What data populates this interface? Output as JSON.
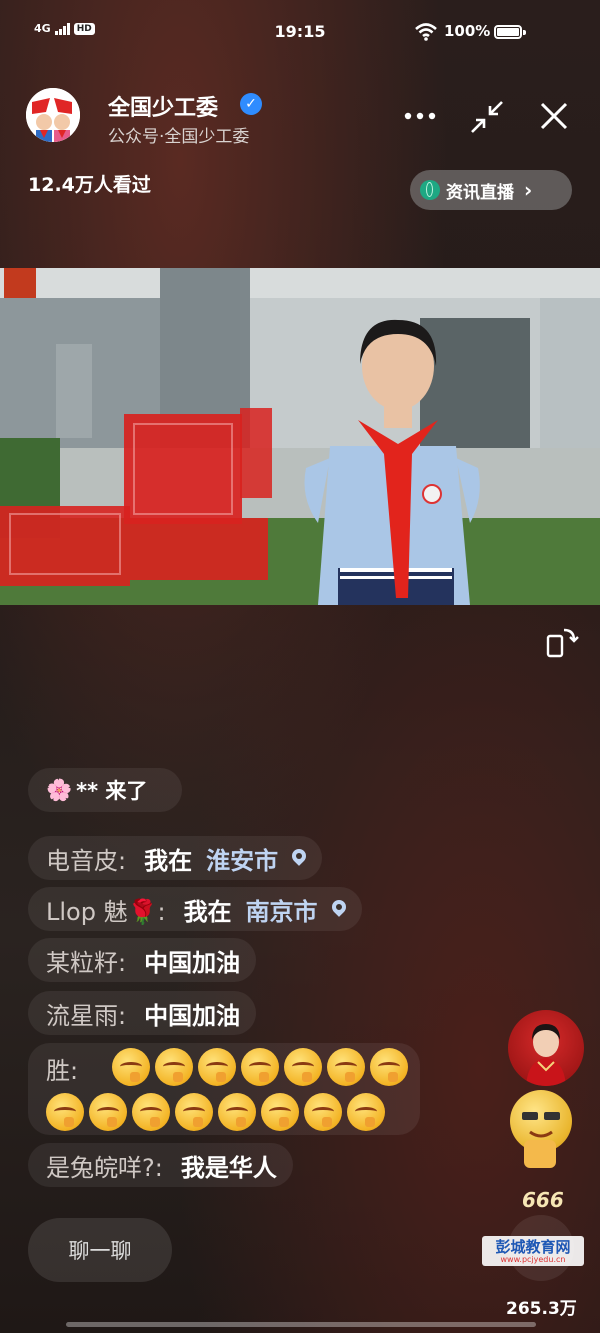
{
  "status_bar": {
    "network": "4G",
    "hd": "HD",
    "time": "19:15",
    "battery": "100%"
  },
  "header": {
    "channel_name": "全国少工委",
    "channel_sub": "公众号·全国少工委",
    "views": "12.4万人看过",
    "live_label": "资讯直播",
    "live_chevron": "›"
  },
  "chat": {
    "join": {
      "emoji": "🌸",
      "text": "** 来了"
    },
    "messages": [
      {
        "nick": "电音皮:",
        "msg": "我在",
        "city": "淮安市"
      },
      {
        "nick": "Llop 魅🌹:",
        "msg": "我在",
        "city": "南京市"
      },
      {
        "nick": "某粒籽:",
        "msg": "中国加油"
      },
      {
        "nick": "流星雨:",
        "msg": "中国加油"
      },
      {
        "nick": "胜:",
        "emoji_row1": 7,
        "emoji_row2": 8
      },
      {
        "nick": "是兔皖咩?:",
        "msg": "我是华人"
      }
    ],
    "chat_button": "聊一聊"
  },
  "side": {
    "six_text": "666",
    "like_count": "265.3万"
  },
  "watermark": {
    "line1": "彭城教育网",
    "line2": "www.pcjyedu.cn"
  },
  "colors": {
    "accent_blue": "#2f8cff",
    "city_blue": "#bfd4f2",
    "globe_green": "#1ea883"
  }
}
